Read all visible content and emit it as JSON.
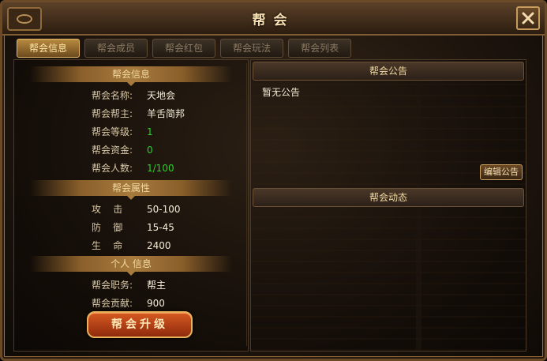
{
  "window": {
    "title": "帮会"
  },
  "tabs": [
    {
      "label": "帮会信息",
      "active": true
    },
    {
      "label": "帮会成员",
      "active": false
    },
    {
      "label": "帮会红包",
      "active": false
    },
    {
      "label": "帮会玩法",
      "active": false
    },
    {
      "label": "帮会列表",
      "active": false
    }
  ],
  "info_section": {
    "title": "帮会信息",
    "rows": [
      {
        "label": "帮会名称:",
        "value": "天地会"
      },
      {
        "label": "帮会帮主:",
        "value": "羊舌简邦"
      },
      {
        "label": "帮会等级:",
        "value": "1"
      },
      {
        "label": "帮会资金:",
        "value": "0"
      },
      {
        "label": "帮会人数:",
        "value": "1/100"
      }
    ]
  },
  "attr_section": {
    "title": "帮会属性",
    "rows": [
      {
        "label": "攻    击",
        "value": "50-100"
      },
      {
        "label": "防    御",
        "value": "15-45"
      },
      {
        "label": "生    命",
        "value": "2400"
      }
    ]
  },
  "personal_section": {
    "title": "个人 信息",
    "rows": [
      {
        "label": "帮会职务:",
        "value": "帮主"
      },
      {
        "label": "帮会贡献:",
        "value": "900"
      }
    ]
  },
  "upgrade_button": "帮会升级",
  "notice": {
    "title": "帮会公告",
    "text": "暂无公告",
    "edit_button": "编辑公告"
  },
  "dynamics": {
    "title": "帮会动态"
  },
  "colors": {
    "accent": "#e2b86b",
    "value_green": "#2ad02a",
    "upgrade": "#c0471a"
  }
}
